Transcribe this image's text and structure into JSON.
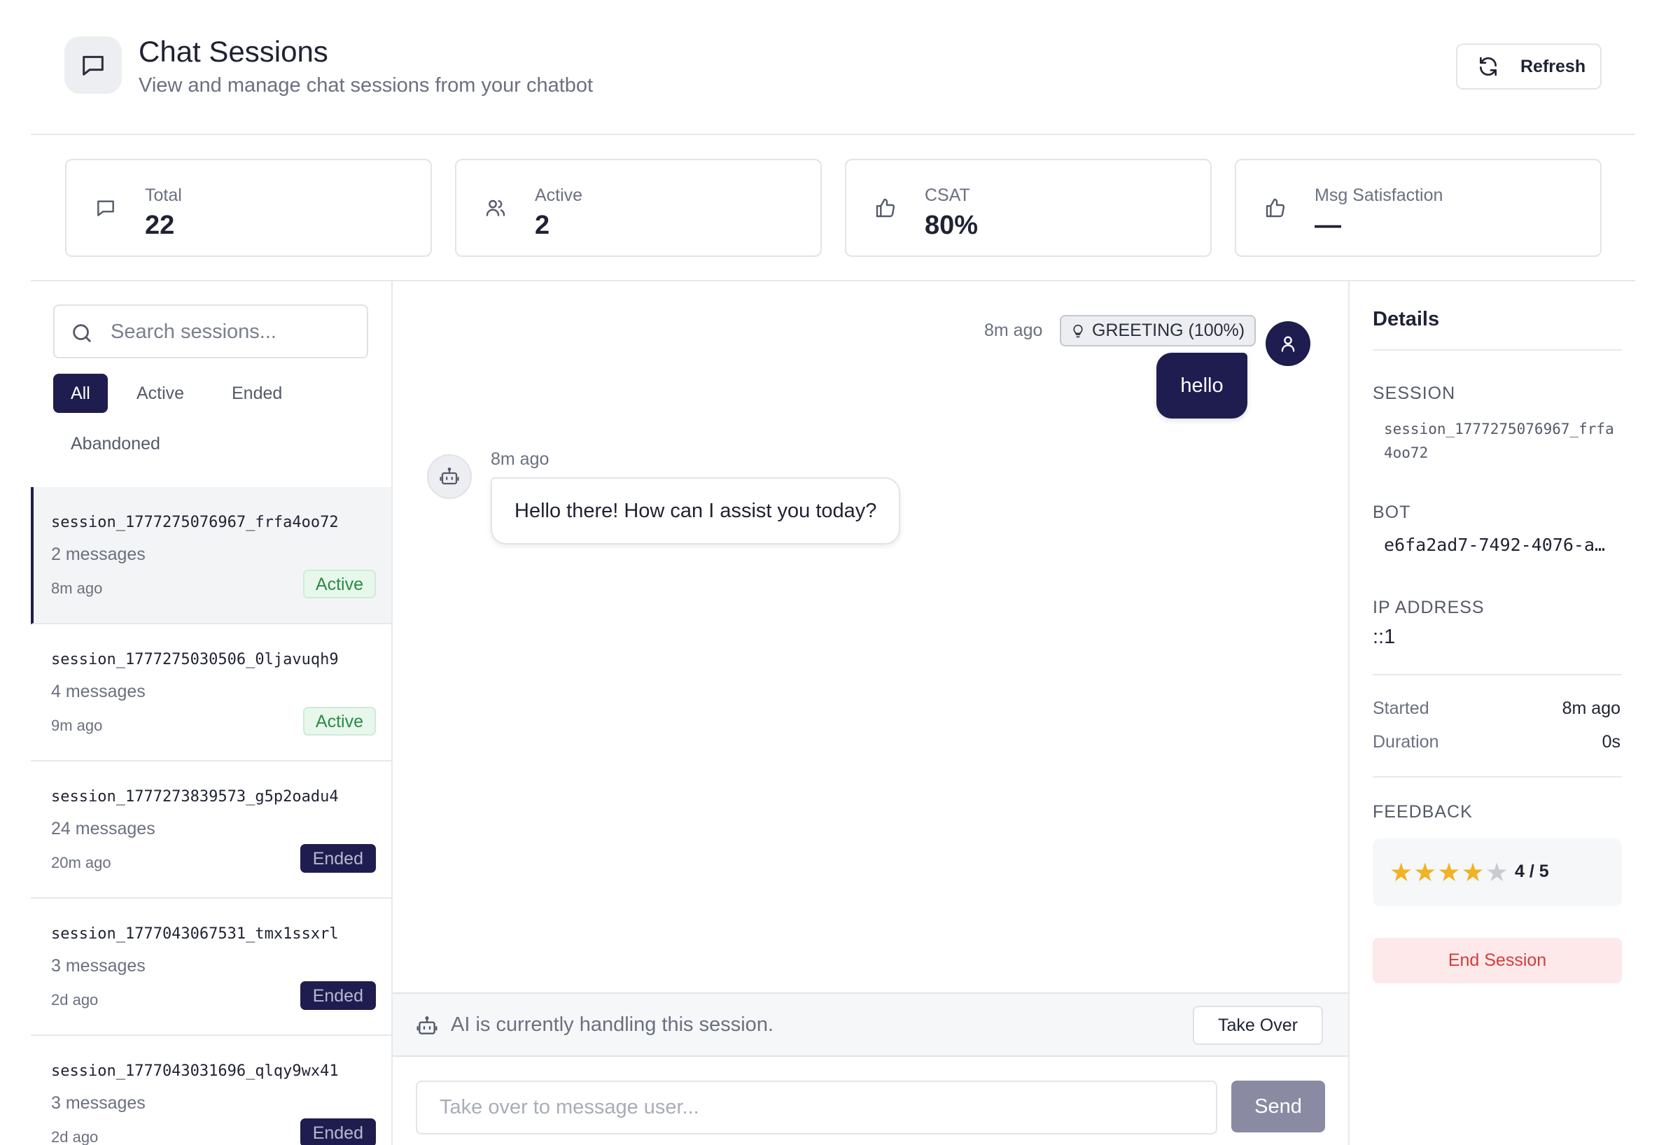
{
  "header": {
    "title": "Chat Sessions",
    "subtitle": "View and manage chat sessions from your chatbot",
    "refresh_label": "Refresh",
    "icon": "chat-bubble-icon"
  },
  "stats": [
    {
      "label": "Total",
      "value": "22",
      "icon": "chat-bubble-icon"
    },
    {
      "label": "Active",
      "value": "2",
      "icon": "users-icon"
    },
    {
      "label": "CSAT",
      "value": "80%",
      "icon": "thumbs-up-icon"
    },
    {
      "label": "Msg Satisfaction",
      "value": "—",
      "icon": "thumbs-up-icon"
    }
  ],
  "search": {
    "placeholder": "Search sessions...",
    "value": ""
  },
  "filters": [
    {
      "label": "All",
      "active": true
    },
    {
      "label": "Active",
      "active": false
    },
    {
      "label": "Ended",
      "active": false
    },
    {
      "label": "Abandoned",
      "active": false
    }
  ],
  "sessions": [
    {
      "id": "session_1777275076967_frfa4oo72",
      "messages": "2 messages",
      "time": "8m ago",
      "status": "Active"
    },
    {
      "id": "session_1777275030506_0ljavuqh9",
      "messages": "4 messages",
      "time": "9m ago",
      "status": "Active"
    },
    {
      "id": "session_1777273839573_g5p2oadu4",
      "messages": "24 messages",
      "time": "20m ago",
      "status": "Ended"
    },
    {
      "id": "session_1777043067531_tmx1ssxrl",
      "messages": "3 messages",
      "time": "2d ago",
      "status": "Ended"
    },
    {
      "id": "session_1777043031696_qlqy9wx41",
      "messages": "3 messages",
      "time": "2d ago",
      "status": "Ended"
    }
  ],
  "chat": {
    "user_message": {
      "time": "8m ago",
      "intent": "GREETING (100%)",
      "text": "hello"
    },
    "bot_message": {
      "time": "8m ago",
      "text": "Hello there! How can I assist you today?"
    },
    "handling_text": "AI is currently handling this session.",
    "takeover_label": "Take Over",
    "input_placeholder": "Take over to message user...",
    "send_label": "Send"
  },
  "details": {
    "title": "Details",
    "session_label": "SESSION",
    "session_id": "session_1777275076967_frfa4oo72",
    "bot_label": "BOT",
    "bot_id": "e6fa2ad7-7492-4076-a4…",
    "ip_label": "IP ADDRESS",
    "ip": "::1",
    "started_label": "Started",
    "started": "8m ago",
    "duration_label": "Duration",
    "duration": "0s",
    "feedback_label": "FEEDBACK",
    "rating": 4,
    "rating_max": 5,
    "rating_text": "4 / 5",
    "end_label": "End Session"
  },
  "colors": {
    "brand": "#1f1d4f",
    "active_badge": "#2a8b43",
    "star": "#f0b323",
    "danger": "#d43c3c"
  }
}
